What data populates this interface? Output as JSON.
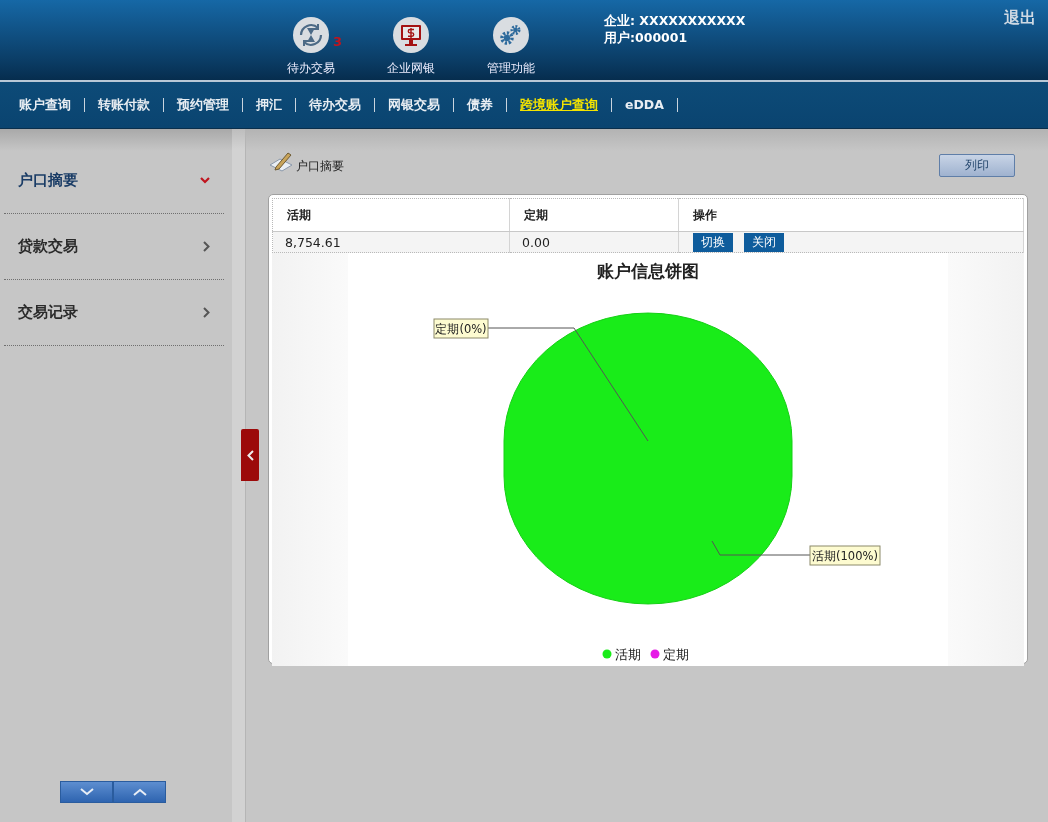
{
  "header": {
    "shortcuts": [
      {
        "kind": "pending",
        "label": "待办交易",
        "badge": "3"
      },
      {
        "kind": "bank",
        "label": "企业网银"
      },
      {
        "kind": "settings",
        "label": "管理功能"
      }
    ],
    "company": "企业: XXXXXXXXXXX",
    "user": "用户:000001",
    "logout": "退出"
  },
  "nav": [
    {
      "label": "账户查询",
      "selected": false
    },
    {
      "label": "转账付款",
      "selected": false
    },
    {
      "label": "预约管理",
      "selected": false
    },
    {
      "label": "押汇",
      "selected": false
    },
    {
      "label": "待办交易",
      "selected": false
    },
    {
      "label": "网银交易",
      "selected": false
    },
    {
      "label": "债券",
      "selected": false
    },
    {
      "label": "跨境账户查询",
      "selected": true
    },
    {
      "label": "eDDA",
      "selected": false
    }
  ],
  "sidebar": {
    "items": [
      {
        "label": "户口摘要",
        "expanded": true
      },
      {
        "label": "贷款交易",
        "expanded": false
      },
      {
        "label": "交易记录",
        "expanded": false
      }
    ]
  },
  "content": {
    "title": "户口摘要",
    "print_button": "列印",
    "table": {
      "columns": [
        "活期",
        "定期",
        "操作"
      ],
      "rows": [
        {
          "cells": [
            "8,754.61",
            "0.00"
          ],
          "actions": [
            "切换",
            "关闭"
          ]
        }
      ]
    },
    "chart": {
      "chart_data": {
        "type": "pie",
        "title": "账户信息饼图",
        "categories": [
          "活期",
          "定期"
        ],
        "colors": [
          "#19ec19",
          "#e619e6"
        ],
        "values": [
          100,
          0
        ],
        "value_labels": [
          "活期(100%)",
          "定期(0%)"
        ]
      }
    }
  }
}
